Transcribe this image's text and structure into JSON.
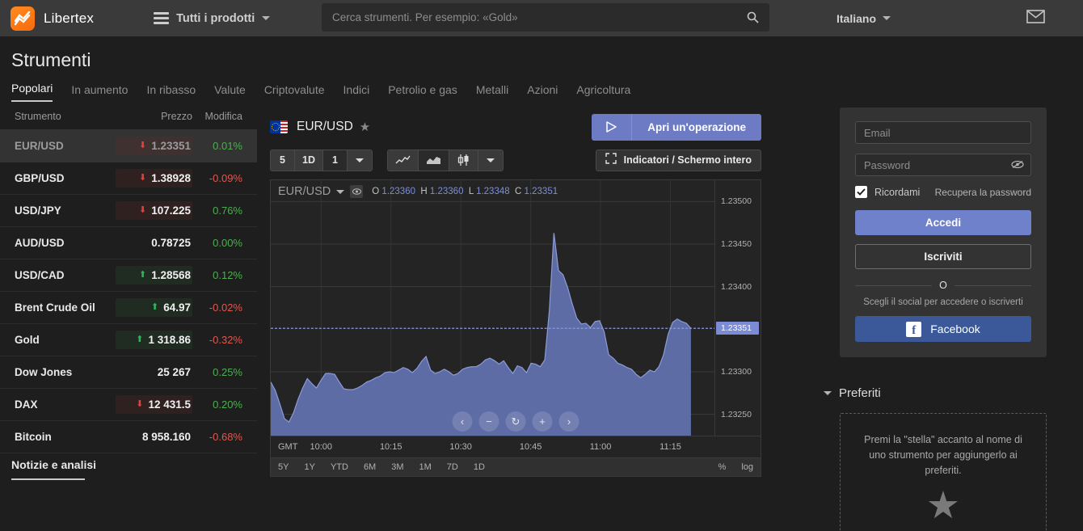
{
  "topbar": {
    "logo_text": "Libertex",
    "logo_icon": "libertex-logo-icon",
    "menu_icon": "hamburger-icon",
    "all_products_label": "Tutti i prodotti",
    "search_placeholder": "Cerca strumenti. Per esempio: «Gold»",
    "search_value": "",
    "search_icon": "search-icon",
    "language_label": "Italiano",
    "mail_icon": "envelope-icon"
  },
  "page": {
    "title": "Strumenti",
    "tabs": [
      {
        "label": "Popolari",
        "active": true
      },
      {
        "label": "In aumento",
        "active": false
      },
      {
        "label": "In ribasso",
        "active": false
      },
      {
        "label": "Valute",
        "active": false
      },
      {
        "label": "Criptovalute",
        "active": false
      },
      {
        "label": "Indici",
        "active": false
      },
      {
        "label": "Petrolio e gas",
        "active": false
      },
      {
        "label": "Metalli",
        "active": false
      },
      {
        "label": "Azioni",
        "active": false
      },
      {
        "label": "Agricoltura",
        "active": false
      }
    ],
    "news_tab_label": "Notizie e analisi"
  },
  "instruments": {
    "columns": [
      "Strumento",
      "Prezzo",
      "Modifica"
    ],
    "rows": [
      {
        "name": "EUR/USD",
        "price": "1.23351",
        "arrow": "down",
        "change": "0.01%",
        "change_sign": "pos",
        "selected": true
      },
      {
        "name": "GBP/USD",
        "price": "1.38928",
        "arrow": "down",
        "change": "-0.09%",
        "change_sign": "neg",
        "selected": false
      },
      {
        "name": "USD/JPY",
        "price": "107.225",
        "arrow": "down",
        "change": "0.76%",
        "change_sign": "pos",
        "selected": false
      },
      {
        "name": "AUD/USD",
        "price": "0.78725",
        "arrow": "none",
        "change": "0.00%",
        "change_sign": "pos",
        "selected": false
      },
      {
        "name": "USD/CAD",
        "price": "1.28568",
        "arrow": "up",
        "change": "0.12%",
        "change_sign": "pos",
        "selected": false
      },
      {
        "name": "Brent Crude Oil",
        "price": "64.97",
        "arrow": "up",
        "change": "-0.02%",
        "change_sign": "neg",
        "selected": false
      },
      {
        "name": "Gold",
        "price": "1 318.86",
        "arrow": "up",
        "change": "-0.32%",
        "change_sign": "neg",
        "selected": false
      },
      {
        "name": "Dow Jones",
        "price": "25 267",
        "arrow": "none",
        "change": "0.25%",
        "change_sign": "pos",
        "selected": false
      },
      {
        "name": "DAX",
        "price": "12 431.5",
        "arrow": "down",
        "change": "0.20%",
        "change_sign": "pos",
        "selected": false
      },
      {
        "name": "Bitcoin",
        "price": "8 958.160",
        "arrow": "none",
        "change": "-0.68%",
        "change_sign": "neg",
        "selected": false
      }
    ]
  },
  "chart_panel": {
    "pair": "EUR/USD",
    "flag_icon": "eur-usd-flag-icon",
    "star_icon": "star-icon",
    "open_trade_label": "Apri un'operazione",
    "play_icon": "play-icon",
    "timeframe_buttons": [
      {
        "label": "5",
        "active": false
      },
      {
        "label": "1D",
        "active": false
      },
      {
        "label": "1",
        "active": true
      }
    ],
    "timeframe_more_icon": "chevron-down-icon",
    "chart_type_buttons": [
      {
        "icon": "line-chart-icon",
        "active": false
      },
      {
        "icon": "area-chart-icon",
        "active": true
      },
      {
        "icon": "candlestick-chart-icon",
        "active": false
      }
    ],
    "chart_type_more_icon": "chevron-down-icon",
    "indicators_label": "Indicatori / Schermo intero",
    "fullscreen_icon": "fullscreen-icon",
    "eye_icon": "eye-icon",
    "dropdown_icon": "chevron-down-icon",
    "nav_buttons": [
      {
        "icon": "chevron-left-icon",
        "glyph": "‹"
      },
      {
        "icon": "minus-icon",
        "glyph": "−"
      },
      {
        "icon": "reset-icon",
        "glyph": "↻"
      },
      {
        "icon": "plus-icon",
        "glyph": "+"
      },
      {
        "icon": "chevron-right-icon",
        "glyph": "›"
      }
    ],
    "period_buttons": [
      "5Y",
      "1Y",
      "YTD",
      "6M",
      "3M",
      "1M",
      "7D",
      "1D"
    ],
    "scale_buttons": [
      "%",
      "log"
    ]
  },
  "chart_data": {
    "type": "area",
    "title": "EUR/USD",
    "xlabel": "GMT",
    "ylabel": "",
    "grid": true,
    "ylim": [
      1.23225,
      1.23525
    ],
    "yticks": [
      "1.23500",
      "1.23450",
      "1.23400",
      "1.23300",
      "1.23250"
    ],
    "ytick_values": [
      1.235,
      1.2345,
      1.234,
      1.233,
      1.2325
    ],
    "xticks": [
      "10:00",
      "10:15",
      "10:30",
      "10:45",
      "11:00",
      "11:15"
    ],
    "last_price": "1.23351",
    "last_price_value": 1.23351,
    "ohlc": {
      "O": "1.23360",
      "H": "1.23360",
      "L": "1.23348",
      "C": "1.23351"
    },
    "series_name": "EUR/USD",
    "line_color": "#8d9bd8",
    "fill_color": "#5e6ca5",
    "values": [
      1.23288,
      1.23278,
      1.23262,
      1.23245,
      1.23241,
      1.23252,
      1.23268,
      1.23281,
      1.23292,
      1.23286,
      1.23281,
      1.2329,
      1.23298,
      1.23298,
      1.23297,
      1.23288,
      1.2328,
      1.23279,
      1.23279,
      1.23281,
      1.23284,
      1.23288,
      1.2329,
      1.23293,
      1.23295,
      1.23299,
      1.233,
      1.23299,
      1.23302,
      1.23305,
      1.23303,
      1.23299,
      1.23304,
      1.23312,
      1.23318,
      1.23302,
      1.23298,
      1.233,
      1.23303,
      1.233,
      1.23296,
      1.23298,
      1.23303,
      1.23305,
      1.23306,
      1.23306,
      1.23309,
      1.23314,
      1.23316,
      1.23313,
      1.23309,
      1.23313,
      1.23305,
      1.23298,
      1.23307,
      1.23305,
      1.23299,
      1.2331,
      1.23309,
      1.23306,
      1.23314,
      1.23372,
      1.23463,
      1.23419,
      1.23414,
      1.23399,
      1.2338,
      1.23363,
      1.23356,
      1.23357,
      1.23352,
      1.23359,
      1.2336,
      1.23347,
      1.2332,
      1.23316,
      1.2331,
      1.23308,
      1.23305,
      1.23303,
      1.23297,
      1.23293,
      1.23297,
      1.23302,
      1.233,
      1.23306,
      1.2332,
      1.23344,
      1.23358,
      1.23362,
      1.23359,
      1.23357,
      1.23351
    ]
  },
  "login": {
    "email_placeholder": "Email",
    "email_value": "",
    "password_placeholder": "Password",
    "password_value": "",
    "eye_icon": "eye-icon",
    "remember_label": "Ricordami",
    "remember_checked": true,
    "recover_label": "Recupera la password",
    "login_label": "Accedi",
    "signup_label": "Iscriviti",
    "or_label": "O",
    "social_note": "Scegli il social per accedere o iscriverti",
    "facebook_label": "Facebook",
    "facebook_glyph": "f",
    "facebook_color": "#3b5998"
  },
  "favorites": {
    "title": "Preferiti",
    "chevron_icon": "chevron-down-icon",
    "empty_text": "Premi la \"stella\" accanto al nome di uno strumento per aggiungerlo ai preferiti.",
    "star_icon": "star-icon",
    "star_glyph": "★"
  }
}
